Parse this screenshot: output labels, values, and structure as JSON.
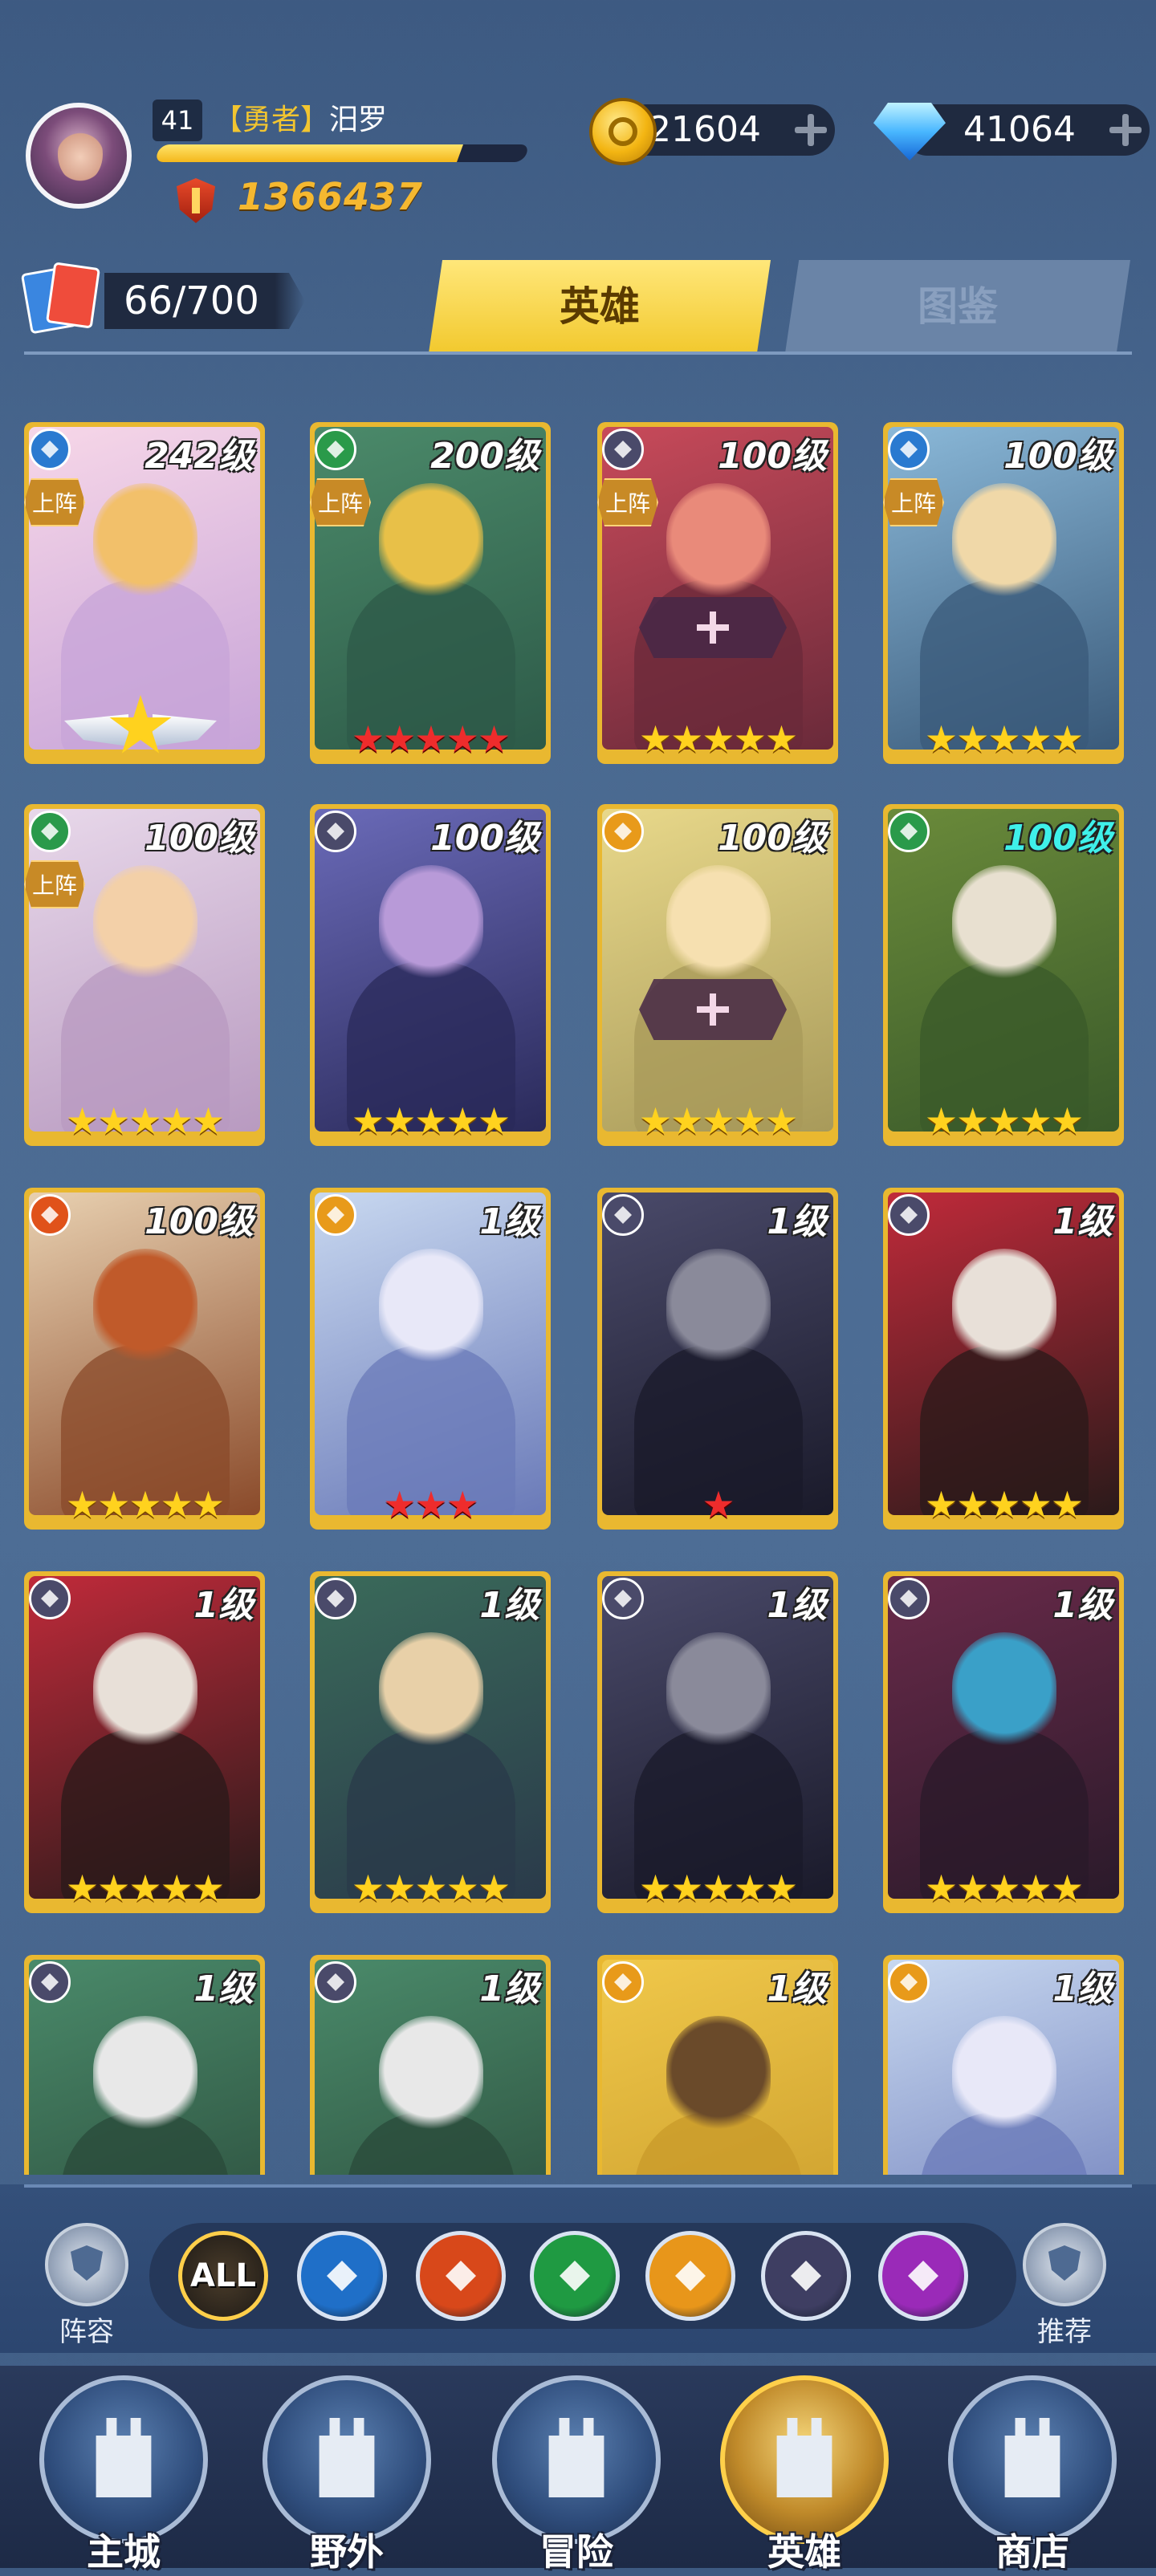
{
  "profile": {
    "level": "41",
    "title_tag": "【勇者】",
    "name": "汨罗",
    "xp_fraction": 0.82,
    "power": "1366437"
  },
  "resources": {
    "gold": "21604",
    "diamonds": "41064"
  },
  "cards_count": "66/700",
  "tabs": [
    {
      "label": "英雄",
      "active": true
    },
    {
      "label": "图鉴",
      "active": false
    }
  ],
  "deploy_label": "上阵",
  "heroes": [
    {
      "level": "242级",
      "element": "water",
      "deployed": true,
      "stars": "★",
      "star_color": "gold",
      "badge": true,
      "colors": [
        "#f7d7e8",
        "#f2c06a",
        "#c7a4d8"
      ]
    },
    {
      "level": "200级",
      "element": "wind",
      "deployed": true,
      "stars": "★★★★★",
      "star_color": "red",
      "colors": [
        "#4b8a6a",
        "#e8c048",
        "#2d5a48"
      ]
    },
    {
      "level": "100级",
      "element": "dark",
      "deployed": true,
      "stars": "★★★★★",
      "star_color": "gold",
      "locked": true,
      "colors": [
        "#c84a5a",
        "#e98a7a",
        "#6a2a3a"
      ]
    },
    {
      "level": "100级",
      "element": "water",
      "deployed": true,
      "stars": "★★★★★",
      "star_color": "gold",
      "colors": [
        "#8ab8d8",
        "#f0d8a8",
        "#3a5a7a"
      ]
    },
    {
      "level": "100级",
      "element": "wind",
      "deployed": true,
      "stars": "★★★★★",
      "star_color": "gold",
      "colors": [
        "#e8d8ea",
        "#f3d0a8",
        "#b89ac0"
      ]
    },
    {
      "level": "100级",
      "element": "dark",
      "stars": "★★★★★",
      "star_color": "gold",
      "colors": [
        "#6a6ab8",
        "#b89ad8",
        "#2a2a5a"
      ]
    },
    {
      "level": "100级",
      "element": "light",
      "stars": "★★★★★",
      "star_color": "gold",
      "locked": true,
      "colors": [
        "#e8d88a",
        "#f6e0b0",
        "#a89a5a"
      ]
    },
    {
      "level": "100级",
      "element": "wind",
      "level_color": "cyan",
      "stars": "★★★★★",
      "star_color": "gold",
      "colors": [
        "#6a8a3a",
        "#e8e0d0",
        "#3a5a2a"
      ]
    },
    {
      "level": "100级",
      "element": "fire",
      "stars": "★★★★★",
      "star_color": "gold",
      "colors": [
        "#e8d0b0",
        "#c05a2a",
        "#8a4a2a"
      ]
    },
    {
      "level": "1级",
      "element": "light",
      "stars": "★★★",
      "star_color": "red",
      "colors": [
        "#c8d8f0",
        "#e8e8f8",
        "#6a7ab8"
      ]
    },
    {
      "level": "1级",
      "element": "dark",
      "stars": "★",
      "star_color": "red",
      "colors": [
        "#4a4a6a",
        "#8a8a9a",
        "#1a1a2a"
      ]
    },
    {
      "level": "1级",
      "element": "dark",
      "stars": "★★★★★",
      "star_color": "gold",
      "colors": [
        "#c02a3a",
        "#e8e0d8",
        "#2a1a1a"
      ]
    },
    {
      "level": "1级",
      "element": "dark",
      "stars": "★★★★★",
      "star_color": "gold",
      "colors": [
        "#c02a3a",
        "#e8e0d8",
        "#2a1a1a"
      ]
    },
    {
      "level": "1级",
      "element": "dark",
      "stars": "★★★★★",
      "star_color": "gold",
      "colors": [
        "#3a6a5a",
        "#e8d0a8",
        "#2a3a4a"
      ]
    },
    {
      "level": "1级",
      "element": "dark",
      "stars": "★★★★★",
      "star_color": "gold",
      "colors": [
        "#4a4a6a",
        "#8a8a9a",
        "#1a1a2a"
      ]
    },
    {
      "level": "1级",
      "element": "dark",
      "stars": "★★★★★",
      "star_color": "gold",
      "colors": [
        "#6a2a4a",
        "#3aa0c8",
        "#2a1a2a"
      ]
    },
    {
      "level": "1级",
      "element": "dark",
      "stars": "",
      "star_color": "gold",
      "colors": [
        "#4a8a6a",
        "#e8e8e8",
        "#2a4a3a"
      ]
    },
    {
      "level": "1级",
      "element": "dark",
      "stars": "",
      "star_color": "gold",
      "colors": [
        "#4a8a6a",
        "#e8e8e8",
        "#2a4a3a"
      ]
    },
    {
      "level": "1级",
      "element": "light",
      "stars": "",
      "star_color": "gold",
      "colors": [
        "#f0c84a",
        "#6a4a2a",
        "#c89a2a"
      ]
    },
    {
      "level": "1级",
      "element": "light",
      "stars": "",
      "star_color": "gold",
      "colors": [
        "#c8d8f0",
        "#e8e8f8",
        "#6a7ab8"
      ]
    }
  ],
  "element_colors": {
    "water": "#2a7ad0",
    "wind": "#2a9a4a",
    "dark": "#4a4a6a",
    "light": "#e89a1a",
    "fire": "#e0521a"
  },
  "filter": {
    "left_label": "阵容",
    "right_label": "推荐",
    "all_label": "ALL",
    "items": [
      {
        "name": "all",
        "color": "#2a2418"
      },
      {
        "name": "water",
        "color": "#1f6fc8"
      },
      {
        "name": "fire",
        "color": "#d8481a"
      },
      {
        "name": "wind",
        "color": "#1f9a42"
      },
      {
        "name": "light",
        "color": "#e8961a"
      },
      {
        "name": "dark",
        "color": "#3e3e62"
      },
      {
        "name": "chaos",
        "color": "#9a2ab8"
      }
    ]
  },
  "nav": [
    {
      "label": "主城",
      "active": false
    },
    {
      "label": "野外",
      "active": false
    },
    {
      "label": "冒险",
      "active": false
    },
    {
      "label": "英雄",
      "active": true
    },
    {
      "label": "商店",
      "active": false
    }
  ]
}
